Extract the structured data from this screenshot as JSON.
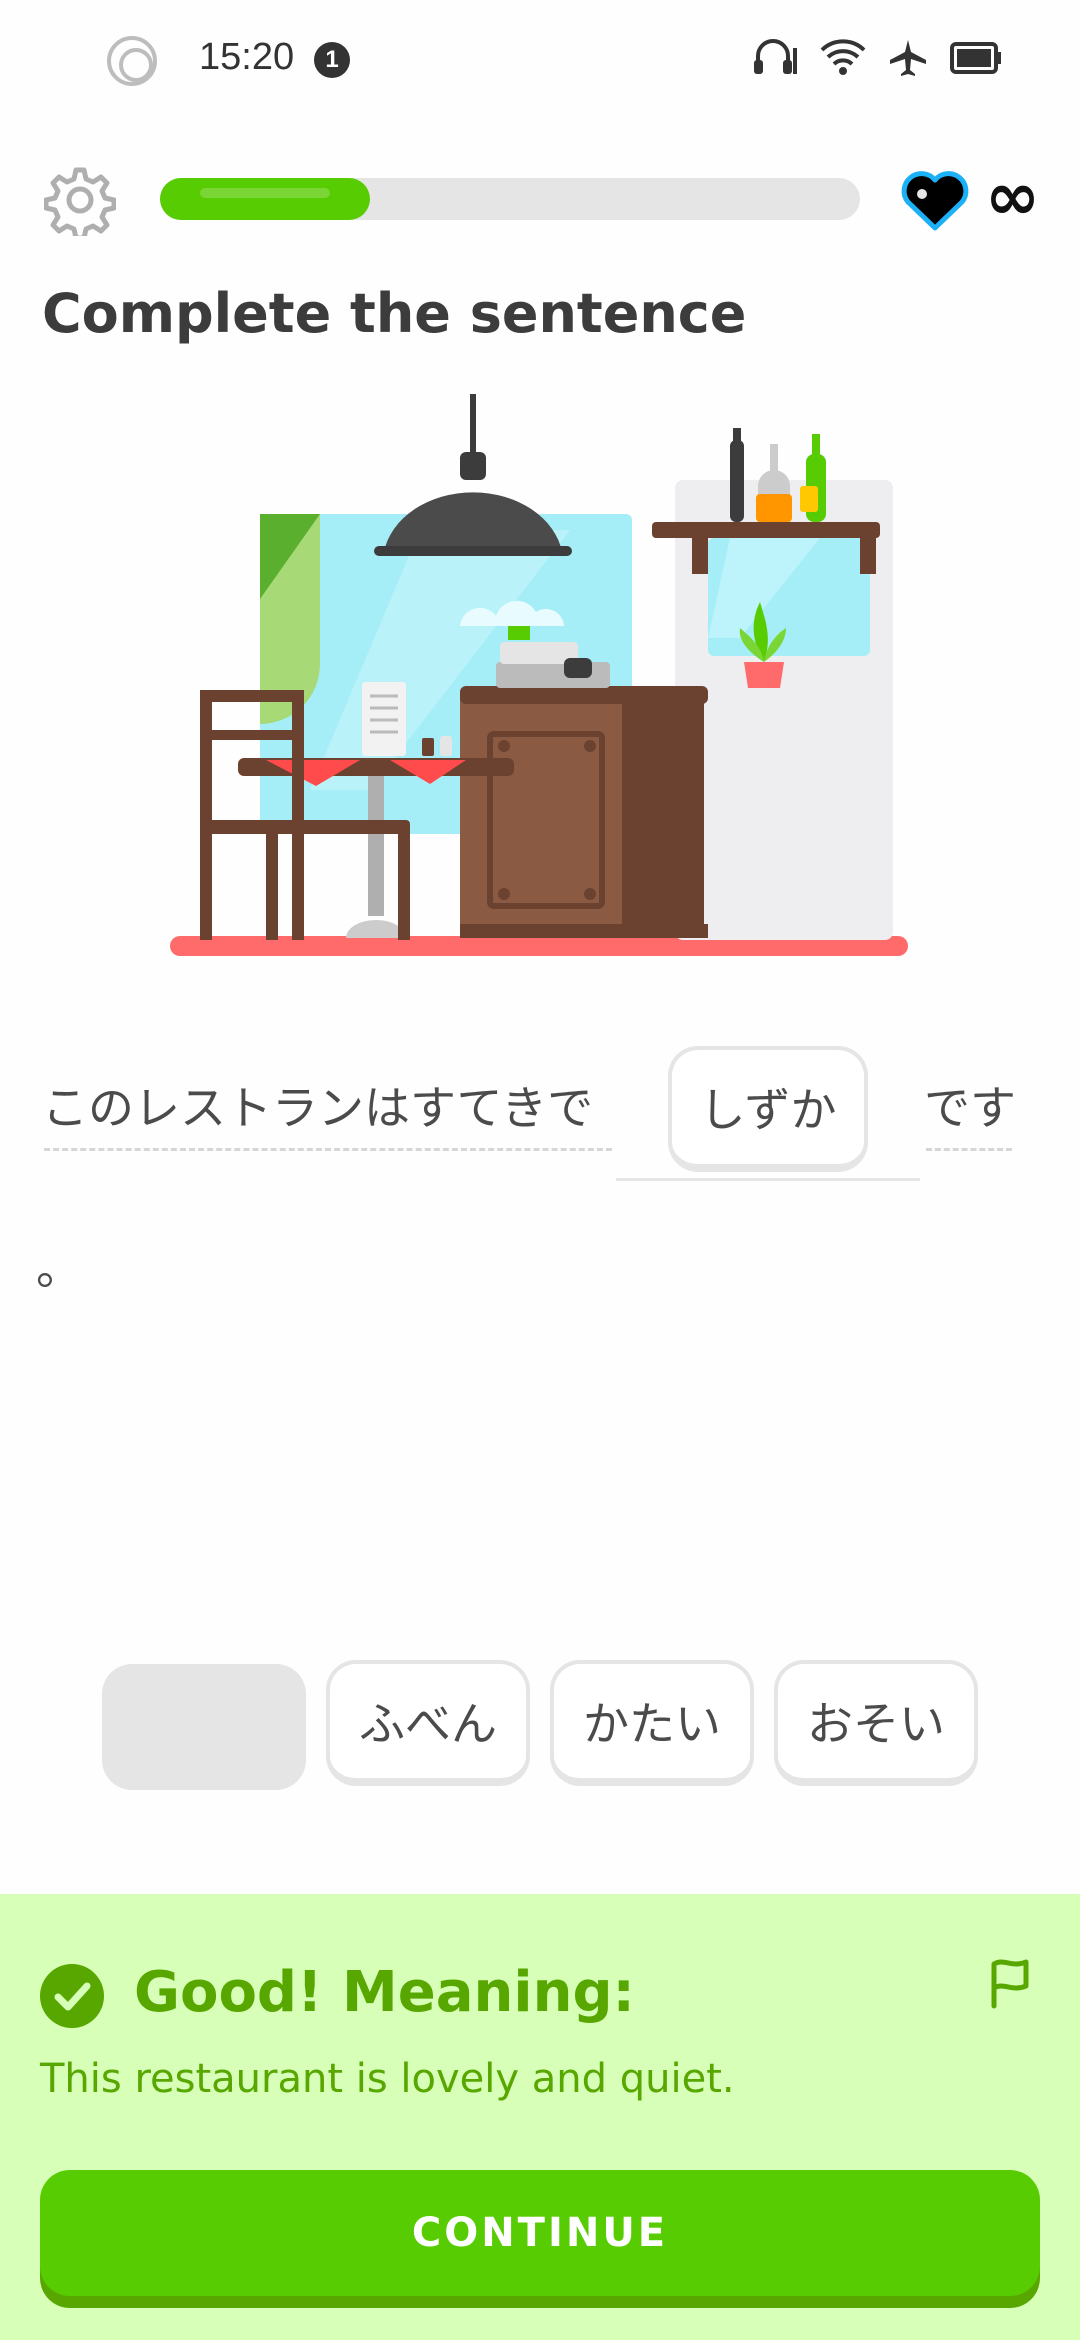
{
  "status_bar": {
    "time": "15:20",
    "notification_count": "1",
    "icons": [
      "record-circle-icon",
      "headset-icon",
      "wifi-icon",
      "airplane-icon",
      "battery-icon"
    ]
  },
  "header": {
    "progress": 0.3,
    "hearts": "∞"
  },
  "prompt": {
    "title": "Complete the sentence"
  },
  "sentence": {
    "before": "このレストランはすてきで",
    "answer": "しずか",
    "after": "です",
    "trailing": "。"
  },
  "word_bank": {
    "options": [
      "ふべん",
      "かたい",
      "おそい"
    ]
  },
  "feedback": {
    "heading": "Good! Meaning:",
    "translation": "This restaurant is lovely and quiet.",
    "continue_label": "CONTINUE"
  },
  "colors": {
    "accent": "#58CC02",
    "accent_dark": "#58A700",
    "feedback_bg": "#D7FFB8"
  }
}
